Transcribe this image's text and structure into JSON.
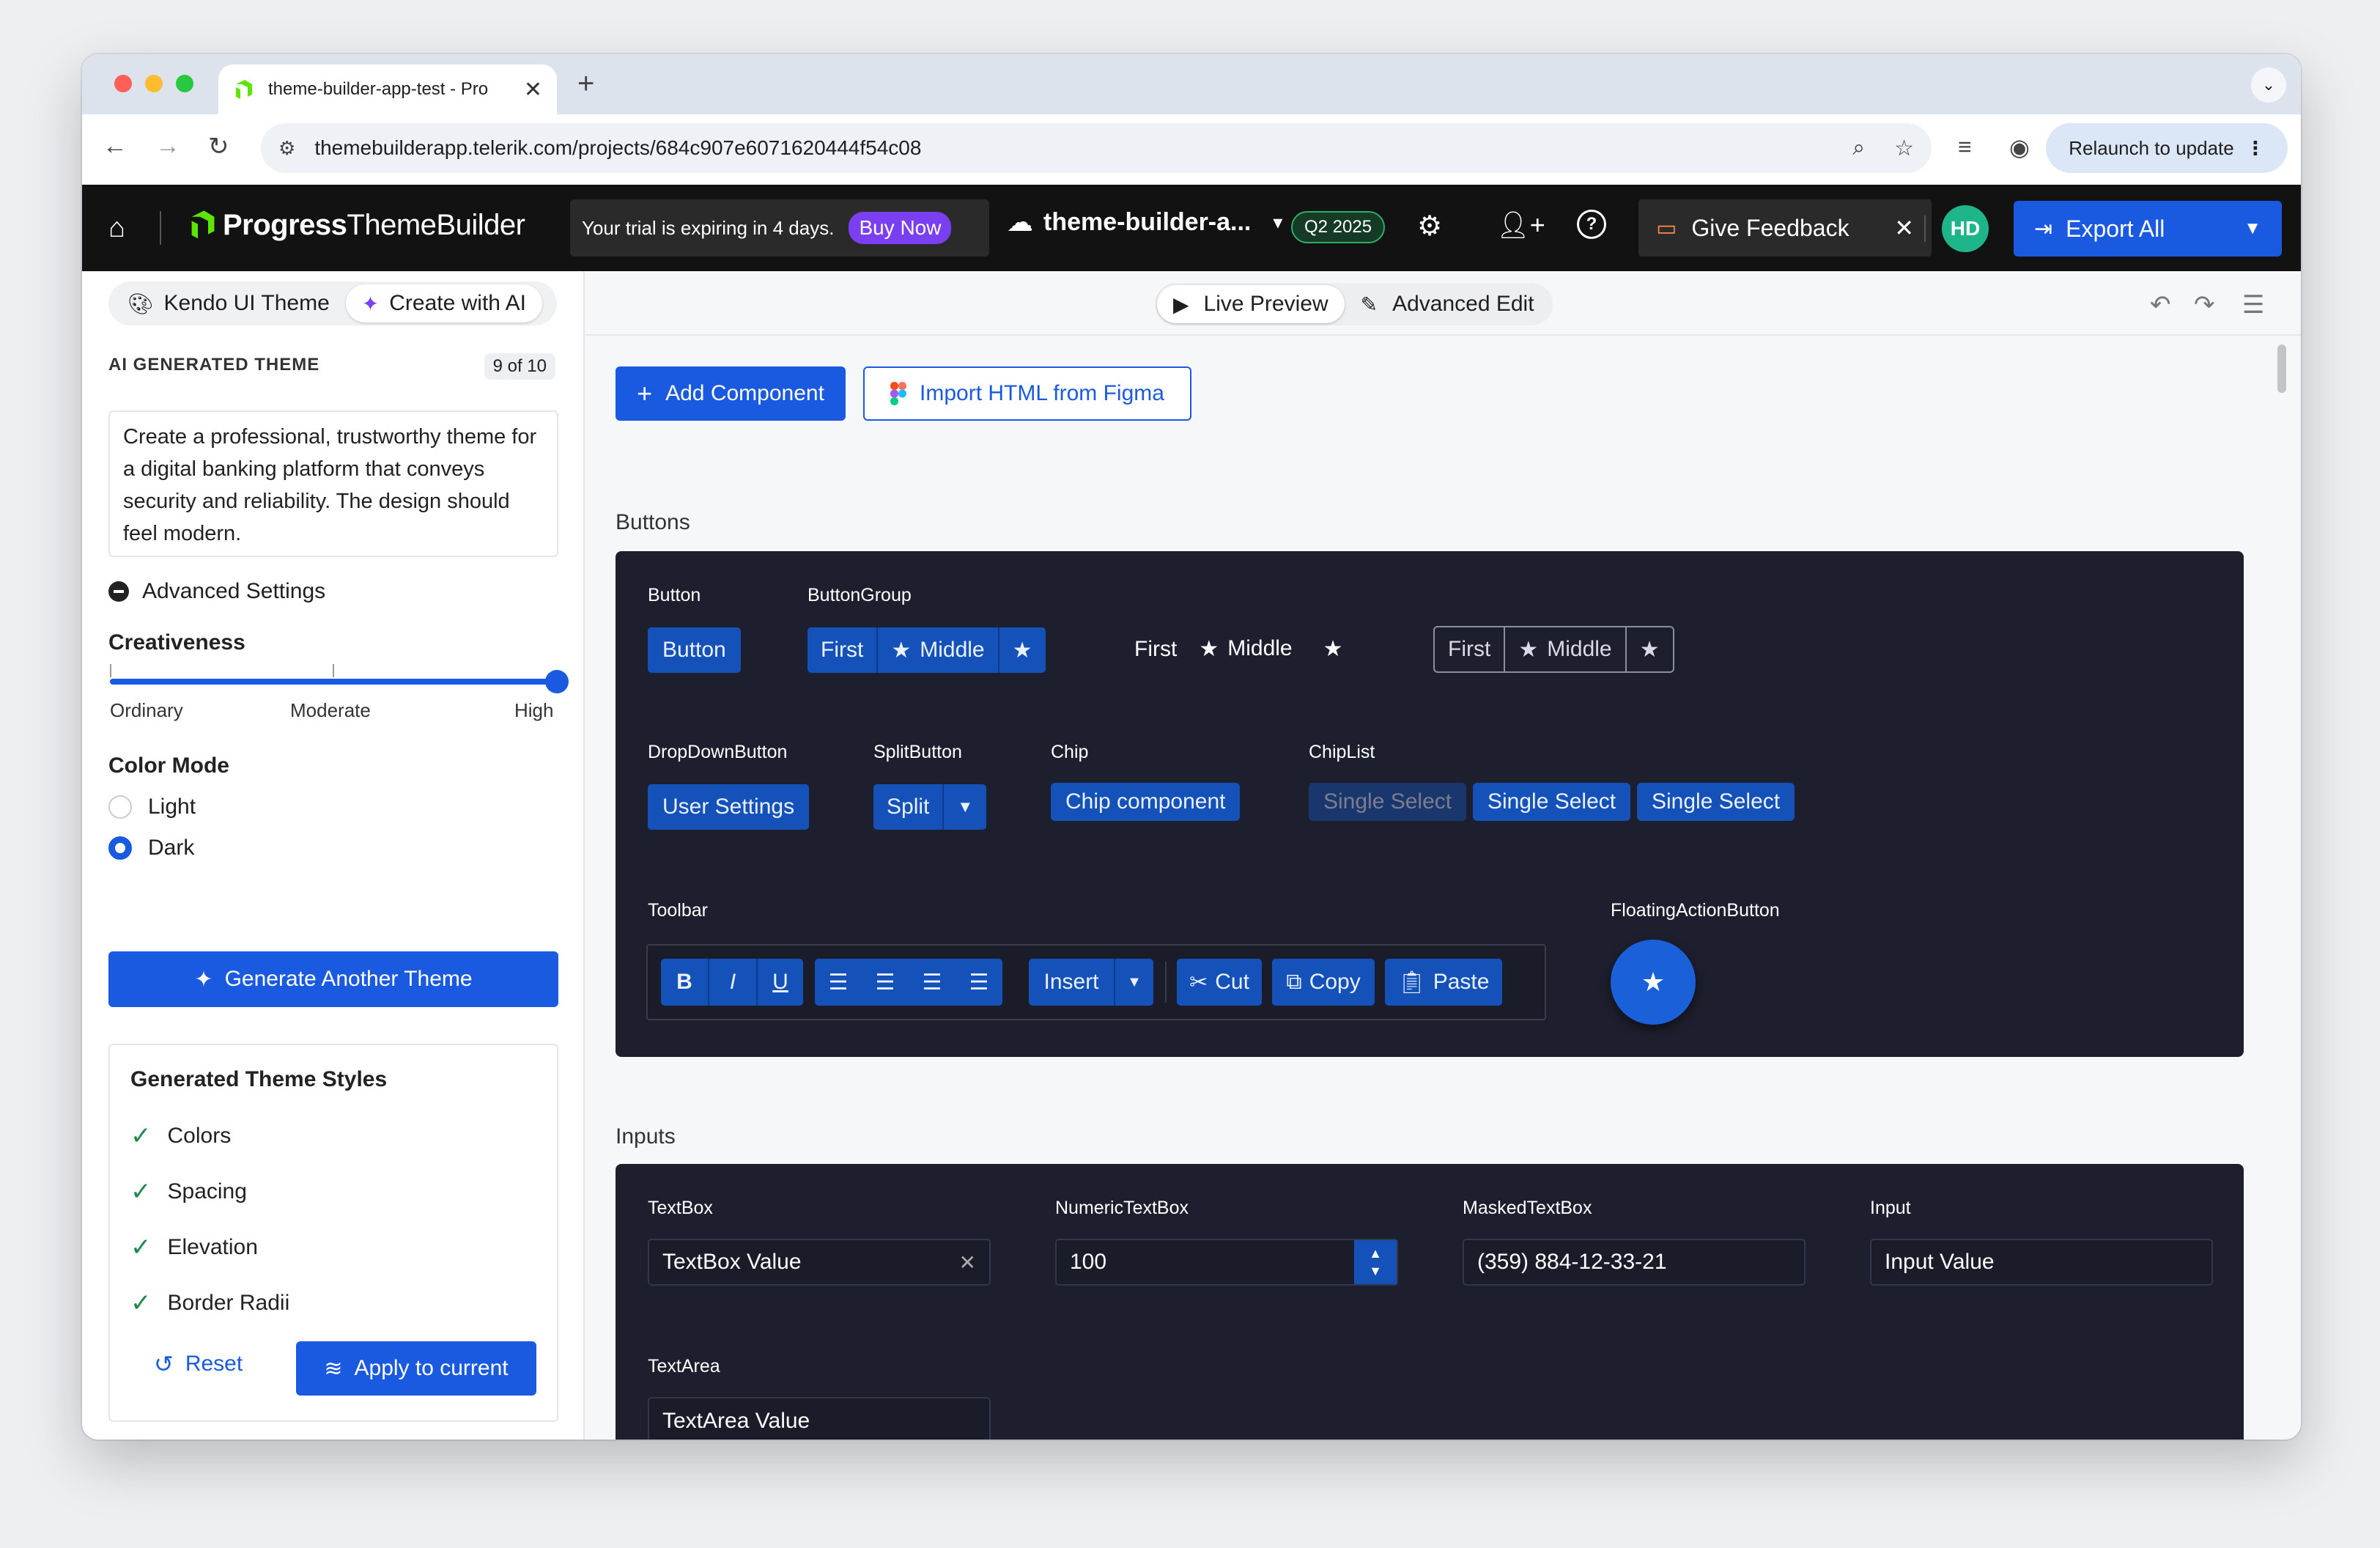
{
  "browser": {
    "tab_title": "theme-builder-app-test - Pro",
    "url": "themebuilderapp.telerik.com/projects/684c907e6071620444f54c08",
    "relaunch_label": "Relaunch to update"
  },
  "header": {
    "brand_bold": "Progress",
    "brand_light": "ThemeBuilder",
    "trial_text": "Your trial is expiring in 4 days.",
    "buy_now": "Buy Now",
    "project_name": "theme-builder-a...",
    "release_badge": "Q2 2025",
    "feedback_label": "Give Feedback",
    "avatar_initials": "HD",
    "export_label": "Export All"
  },
  "sidebar": {
    "tabs": [
      "Kendo UI Theme",
      "Create with AI"
    ],
    "section_label": "AI GENERATED THEME",
    "counter": "9 of 10",
    "prompt": "Create a professional, trustworthy theme for a digital banking platform that conveys security and reliability. The design should feel modern.",
    "advanced_settings": "Advanced Settings",
    "creativeness_label": "Creativeness",
    "creativeness_level": 1.0,
    "slider_labels": [
      "Ordinary",
      "Moderate",
      "High"
    ],
    "color_mode_label": "Color Mode",
    "color_modes": [
      "Light",
      "Dark"
    ],
    "selected_mode": "Dark",
    "generate_label": "Generate Another Theme",
    "styles_title": "Generated Theme Styles",
    "styles": [
      "Colors",
      "Spacing",
      "Elevation",
      "Border Radii"
    ],
    "reset_label": "Reset",
    "apply_label": "Apply to current"
  },
  "main": {
    "modes": [
      "Live Preview",
      "Advanced Edit"
    ],
    "add_component": "Add Component",
    "import_figma": "Import HTML from Figma",
    "buttons_section": "Buttons",
    "inputs_section": "Inputs",
    "labels": {
      "button": "Button",
      "buttongroup": "ButtonGroup",
      "dropdownbutton": "DropDownButton",
      "splitbutton": "SplitButton",
      "chip": "Chip",
      "chiplist": "ChipList",
      "toolbar": "Toolbar",
      "fab": "FloatingActionButton",
      "textbox": "TextBox",
      "numerictextbox": "NumericTextBox",
      "maskedtextbox": "MaskedTextBox",
      "input": "Input",
      "textarea": "TextArea"
    },
    "button_text": "Button",
    "group_first": "First",
    "group_middle": "Middle",
    "dropdown_text": "User Settings",
    "split_text": "Split",
    "chip_text": "Chip component",
    "chiplist_items": [
      "Single Select",
      "Single Select",
      "Single Select"
    ],
    "toolbar": {
      "bold": "B",
      "italic": "I",
      "underline": "U",
      "insert": "Insert",
      "cut": "Cut",
      "copy": "Copy",
      "paste": "Paste"
    },
    "textbox_value": "TextBox Value",
    "numeric_value": "100",
    "masked_value": "(359) 884-12-33-21",
    "input_value": "Input Value",
    "textarea_value": "TextArea Value"
  }
}
